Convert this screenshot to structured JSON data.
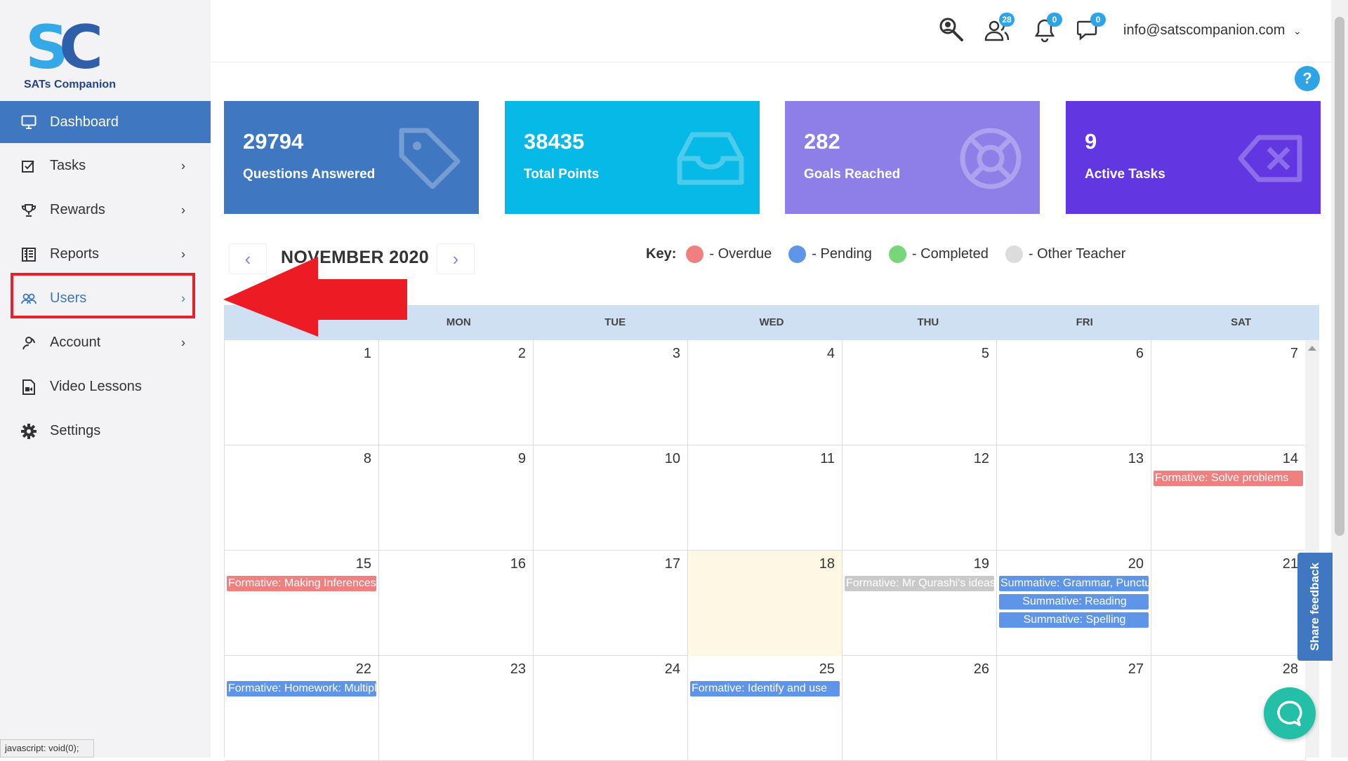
{
  "brand": {
    "logo_text": "SATs Companion",
    "logo_mark": "SC"
  },
  "sidebar": {
    "items": [
      {
        "label": "Dashboard",
        "icon": "monitor-icon",
        "active": true
      },
      {
        "label": "Tasks",
        "icon": "tasks-icon",
        "has_submenu": true
      },
      {
        "label": "Rewards",
        "icon": "trophy-icon",
        "has_submenu": true
      },
      {
        "label": "Reports",
        "icon": "reports-icon",
        "has_submenu": true
      },
      {
        "label": "Users",
        "icon": "users-icon",
        "has_submenu": true,
        "highlighted": true
      },
      {
        "label": "Account",
        "icon": "account-icon",
        "has_submenu": true
      },
      {
        "label": "Video Lessons",
        "icon": "video-icon"
      },
      {
        "label": "Settings",
        "icon": "gear-icon"
      }
    ]
  },
  "header": {
    "users_badge": "28",
    "notifications_badge": "0",
    "messages_badge": "0",
    "user_email": "info@satscompanion.com",
    "help_label": "?"
  },
  "stats": [
    {
      "value": "29794",
      "label": "Questions Answered",
      "color": "#3f77c0",
      "icon": "tag-icon"
    },
    {
      "value": "38435",
      "label": "Total Points",
      "color": "#07b9e6",
      "icon": "inbox-icon"
    },
    {
      "value": "282",
      "label": "Goals Reached",
      "color": "#8e7ee8",
      "icon": "lifebuoy-icon"
    },
    {
      "value": "9",
      "label": "Active Tasks",
      "color": "#6236e0",
      "icon": "backspace-icon"
    }
  ],
  "calendar": {
    "title": "NOVEMBER 2020",
    "prev_label": "‹",
    "next_label": "›",
    "key": {
      "label": "Key:",
      "items": [
        {
          "label": "- Overdue",
          "color": "#f08080"
        },
        {
          "label": "- Pending",
          "color": "#5e95e8"
        },
        {
          "label": "- Completed",
          "color": "#77d67a"
        },
        {
          "label": "- Other Teacher",
          "color": "#dcdcdc"
        }
      ]
    },
    "weekdays": [
      "",
      "MON",
      "TUE",
      "WED",
      "THU",
      "FRI",
      "SAT"
    ],
    "weeks": [
      [
        "1",
        "2",
        "3",
        "4",
        "5",
        "6",
        "7"
      ],
      [
        "8",
        "9",
        "10",
        "11",
        "12",
        "13",
        "14"
      ],
      [
        "15",
        "16",
        "17",
        "18",
        "19",
        "20",
        "21"
      ],
      [
        "22",
        "23",
        "24",
        "25",
        "26",
        "27",
        "28"
      ]
    ],
    "events": {
      "d14": "Formative: Solve problems",
      "d15": "Formative: Making Inferences",
      "d19": "Formative: Mr Qurashi's ideas",
      "d20a": "Summative: Grammar, Punctuation",
      "d20b": "Summative: Reading",
      "d20c": "Summative: Spelling",
      "d22": "Formative: Homework: Multiply",
      "d25": "Formative: Identify and use"
    }
  },
  "feedback_label": "Share feedback",
  "status_bar": "javascript: void(0);"
}
